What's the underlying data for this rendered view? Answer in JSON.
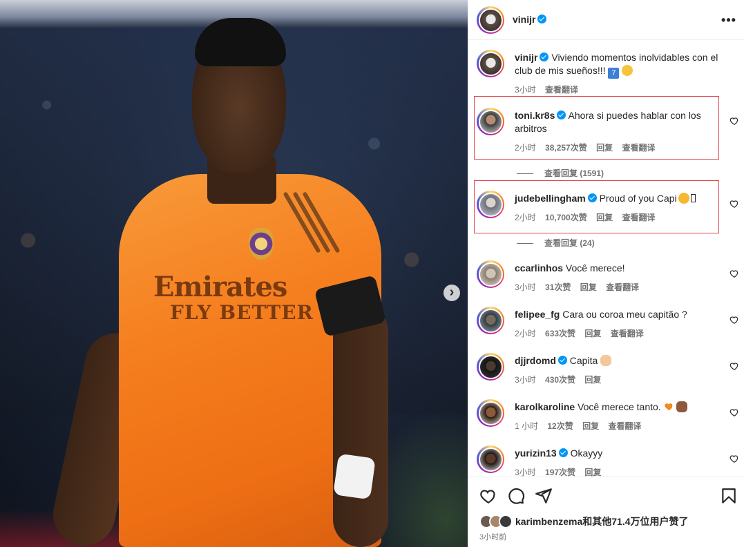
{
  "post": {
    "owner": "vinijr",
    "more_glyph": "•••",
    "photo": {
      "sponsor_line1": "Emirates",
      "sponsor_line2": "FLY BETTER",
      "next_glyph": "›"
    },
    "caption": {
      "username": "vinijr",
      "text": "Viviendo momentos inolvidables con el club de mis sueños!!! ",
      "emoji_box": "7",
      "time": "3小时",
      "translate": "查看翻译"
    }
  },
  "comments": [
    {
      "username": "toni.kr8s",
      "verified": true,
      "text": "Ahora si puedes hablar con los arbitros",
      "time": "2小时",
      "likes": "38,257次赞",
      "reply": "回复",
      "translate": "查看翻译",
      "view_replies": "查看回复 (1591)",
      "highlighted": true
    },
    {
      "username": "judebellingham",
      "verified": true,
      "text": "Proud of you Capi",
      "time": "2小时",
      "likes": "10,700次赞",
      "reply": "回复",
      "translate": "查看翻译",
      "view_replies": "查看回复 (24)",
      "highlighted": true
    },
    {
      "username": "ccarlinhos",
      "verified": false,
      "text": "Você merece!",
      "time": "3小时",
      "likes": "31次赞",
      "reply": "回复",
      "translate": "查看翻译"
    },
    {
      "username": "felipee_fg",
      "verified": false,
      "text": "Cara ou coroa meu capitão ?",
      "time": "2小时",
      "likes": "633次赞",
      "reply": "回复",
      "translate": "查看翻译"
    },
    {
      "username": "djjrdomd",
      "verified": true,
      "text": "Capita",
      "time": "3小时",
      "likes": "430次赞",
      "reply": "回复",
      "translate": ""
    },
    {
      "username": "karolkaroline",
      "verified": false,
      "text": "Você merece tanto.",
      "time": "1 小时",
      "likes": "12次赞",
      "reply": "回复",
      "translate": "查看翻译"
    },
    {
      "username": "yurizin13",
      "verified": true,
      "text": "Okayyy",
      "time": "3小时",
      "likes": "197次赞",
      "reply": "回复",
      "translate": ""
    }
  ],
  "footer": {
    "liked_by": "karimbenzema和其他71.4万位用户赞了",
    "time_ago": "3小时前"
  },
  "colors": {
    "highlight_border": "#e0434b",
    "verified": "#0095f6",
    "jersey_orange": "#f57e1e"
  },
  "icons": [
    "more-icon",
    "verified-icon",
    "heart-icon",
    "comment-icon",
    "share-icon",
    "bookmark-icon",
    "chevron-right-icon"
  ]
}
